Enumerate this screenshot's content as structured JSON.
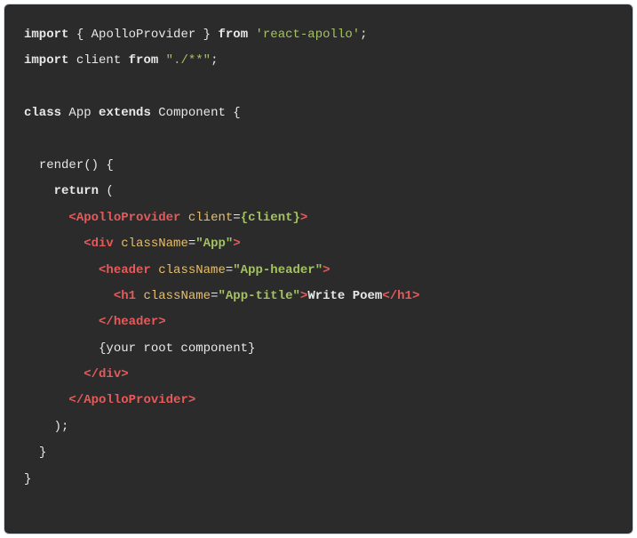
{
  "code": {
    "l1_import": "import",
    "l1_brace_open": " { ",
    "l1_apollo": "ApolloProvider",
    "l1_brace_close": " } ",
    "l1_from": "from",
    "l1_sp": " ",
    "l1_pkg": "'react-apollo'",
    "l1_semi": ";",
    "l2_import": "import",
    "l2_sp1": " ",
    "l2_client": "client",
    "l2_sp2": " ",
    "l2_from": "from",
    "l2_sp3": " ",
    "l2_path": "\"./**\"",
    "l2_semi": ";",
    "l4_class": "class",
    "l4_sp1": " ",
    "l4_app": "App",
    "l4_sp2": " ",
    "l4_extends": "extends",
    "l4_sp3": " ",
    "l4_comp": "Component",
    "l4_brace": " {",
    "l6_indent": "  ",
    "l6_render": "render() {",
    "l7_indent": "    ",
    "l7_return": "return",
    "l7_paren": " (",
    "l8_indent": "      ",
    "l8_open": "<",
    "l8_tag": "ApolloProvider",
    "l8_sp": " ",
    "l8_attr": "client",
    "l8_eq": "=",
    "l8_val": "{client}",
    "l8_close": ">",
    "l9_indent": "        ",
    "l9_open": "<",
    "l9_tag": "div",
    "l9_sp": " ",
    "l9_attr": "className",
    "l9_eq": "=",
    "l9_val": "\"App\"",
    "l9_close": ">",
    "l10_indent": "          ",
    "l10_open": "<",
    "l10_tag": "header",
    "l10_sp": " ",
    "l10_attr": "className",
    "l10_eq": "=",
    "l10_val": "\"App-header\"",
    "l10_close": ">",
    "l11_indent": "            ",
    "l11_open": "<",
    "l11_tag": "h1",
    "l11_sp": " ",
    "l11_attr": "className",
    "l11_eq": "=",
    "l11_val": "\"App-title\"",
    "l11_close": ">",
    "l11_text": "Write Poem",
    "l11_copen": "</",
    "l11_ctag": "h1",
    "l11_cclose": ">",
    "l12_indent": "          ",
    "l12_copen": "</",
    "l12_ctag": "header",
    "l12_cclose": ">",
    "l13_indent": "          ",
    "l13_text": "{your root component}",
    "l14_indent": "        ",
    "l14_copen": "</",
    "l14_ctag": "div",
    "l14_cclose": ">",
    "l15_indent": "      ",
    "l15_copen": "</",
    "l15_ctag": "ApolloProvider",
    "l15_cclose": ">",
    "l16_indent": "    ",
    "l16_paren": ");",
    "l17_indent": "  ",
    "l17_brace": "}",
    "l18_brace": "}"
  }
}
